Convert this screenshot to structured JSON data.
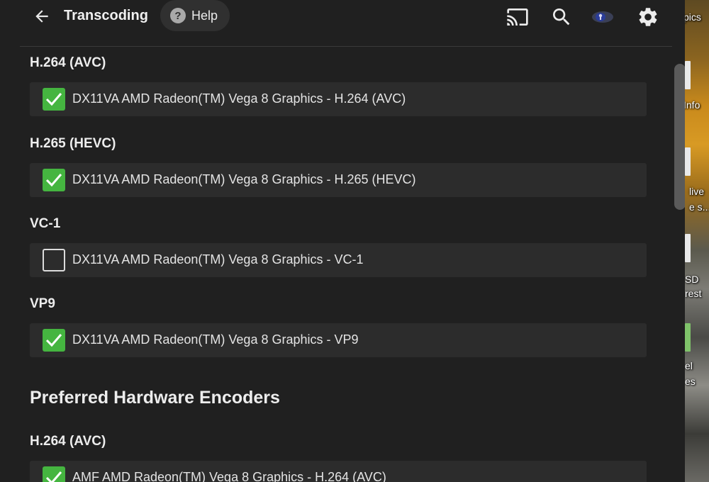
{
  "header": {
    "title": "Transcoding",
    "help_label": "Help",
    "icons": [
      "back-arrow-icon",
      "cast-icon",
      "search-icon",
      "user-avatar-icon",
      "settings-icon"
    ]
  },
  "decoding_groups": [
    {
      "heading": "H.264 (AVC)",
      "option": {
        "label": "DX11VA AMD Radeon(TM) Vega 8 Graphics - H.264 (AVC)",
        "checked": true
      }
    },
    {
      "heading": "H.265 (HEVC)",
      "option": {
        "label": "DX11VA AMD Radeon(TM) Vega 8 Graphics - H.265 (HEVC)",
        "checked": true
      }
    },
    {
      "heading": "VC-1",
      "option": {
        "label": "DX11VA AMD Radeon(TM) Vega 8 Graphics - VC-1",
        "checked": false
      }
    },
    {
      "heading": "VP9",
      "option": {
        "label": "DX11VA AMD Radeon(TM) Vega 8 Graphics - VP9",
        "checked": true
      }
    }
  ],
  "encoders": {
    "section_title": "Preferred Hardware Encoders",
    "groups": [
      {
        "heading": "H.264 (AVC)",
        "option": {
          "label": "AMF AMD Radeon(TM) Vega 8 Graphics - H.264 (AVC)",
          "checked": true
        }
      }
    ]
  },
  "desktop": {
    "labels": [
      "pics",
      "Info",
      "live",
      "e s...",
      "SD",
      "rest",
      "el",
      "es"
    ]
  },
  "colors": {
    "background": "#202020",
    "row": "#2c2c2c",
    "checkbox_checked": "#45b540"
  }
}
